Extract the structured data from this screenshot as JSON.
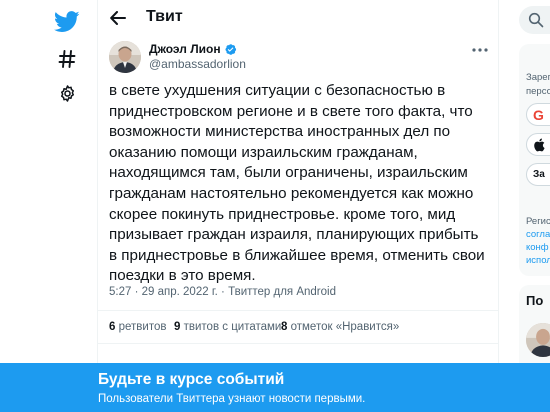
{
  "colors": {
    "accent": "#1d9bf0",
    "text": "#0f1419",
    "secondary": "#536471",
    "banner": "#1d9bf0"
  },
  "nav": {
    "icons": [
      "twitter-logo",
      "hashtag-icon",
      "gear-icon"
    ]
  },
  "header": {
    "title": "Твит"
  },
  "tweet": {
    "author_name": "Джоэл Лион",
    "author_handle": "@ambassadorlion",
    "text": "в свете ухудшения ситуации с безопасностью в приднестровском регионе и в свете того факта, что возможности министерства иностранных дел по оказанию помощи израильским гражданам, находящимся там, были ограничены, израильским гражданам настоятельно рекомендуется как можно скорее покинуть приднестровье. кроме того, мид призывает граждан израиля, планирующих прибыть в приднестровье в ближайшее время, отменить свои поездки в это время.",
    "time": "5:27",
    "separator": "·",
    "date": "29 апр. 2022 г.",
    "source": "Твиттер для Android",
    "stats": [
      {
        "count": "6",
        "label": "ретвитов"
      },
      {
        "count": "9",
        "label": "твитов с цитатами"
      },
      {
        "count": "8",
        "label": "отметок «Нравится»"
      }
    ]
  },
  "sidebar": {
    "signup_text_1": "Зарег",
    "signup_text_2": "персо",
    "google_btn": "G",
    "apple_btn": "",
    "signup_btn": "За",
    "terms_1": "Регис",
    "terms_2": "согла",
    "terms_3": "конф",
    "terms_4": "испол",
    "more_title": "По"
  },
  "banner": {
    "title": "Будьте в курсе событий",
    "subtitle": "Пользователи Твиттера узнают новости первыми."
  }
}
